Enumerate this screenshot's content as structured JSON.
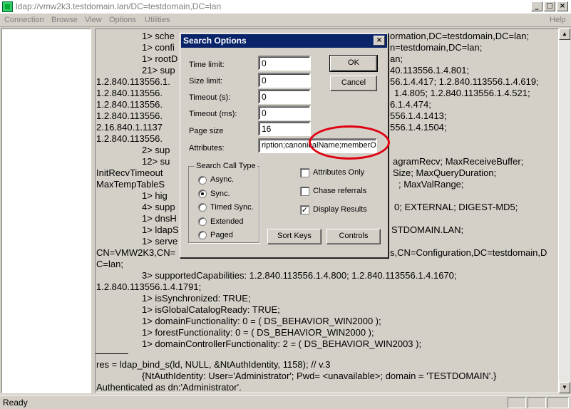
{
  "window": {
    "title": "ldap://vmw2k3.testdomain.lan/DC=testdomain,DC=lan",
    "min": "_",
    "max": "□",
    "close": "×"
  },
  "menu": {
    "items": [
      "Connection",
      "Browse",
      "View",
      "Options",
      "Utilities"
    ],
    "help": "Help"
  },
  "output": {
    "lines": [
      "1> sche",
      "1> confi",
      "1> rootD",
      "21> sup",
      "1.2.840.113556.1.",
      "1.2.840.113556.",
      "1.2.840.113556.",
      "1.2.840.113556.",
      "2.16.840.1.1137",
      "1.2.840.113556.",
      "2> sup",
      "12> su",
      "InitRecvTimeout",
      "MaxTempTableS",
      "1> hig",
      "4> supp",
      "1> dnsH",
      "1> ldapS",
      "1> serve",
      "CN=VMW2K3,CN=",
      "C=lan;",
      "3> supportedCapabilities: 1.2.840.113556.1.4.800; 1.2.840.113556.1.4.1670;",
      "1.2.840.113556.1.4.1791;",
      "1> isSynchronized: TRUE;",
      "1> isGlobalCatalogReady: TRUE;",
      "1> domainFunctionality: 0 = ( DS_BEHAVIOR_WIN2000 );",
      "1> forestFunctionality: 0 = ( DS_BEHAVIOR_WIN2000 );",
      "1> domainControllerFunctionality: 2 = ( DS_BEHAVIOR_WIN2003 );",
      "res = ldap_bind_s(ld, NULL, &NtAuthIdentity, 1158); // v.3",
      "{NtAuthIdentity: User='Administrator'; Pwd= <unavailable>; domain = 'TESTDOMAIN'.}",
      "Authenticated as dn:'Administrator'."
    ],
    "right_lines": [
      "ormation,DC=testdomain,DC=lan;",
      "n=testdomain,DC=lan;",
      "an;",
      "40.113556.1.4.801;",
      "56.1.4.417; 1.2.840.113556.1.4.619;",
      "1.4.805; 1.2.840.113556.1.4.521;",
      "6.1.4.474;",
      "556.1.4.1413;",
      "556.1.4.1504;",
      "agramRecv; MaxReceiveBuffer;",
      "Size; MaxQueryDuration;",
      "; MaxValRange;",
      "0; EXTERNAL; DIGEST-MD5;",
      "STDOMAIN.LAN;",
      "s,CN=Configuration,DC=testdomain,D"
    ]
  },
  "dialog": {
    "title": "Search Options",
    "close": "×",
    "time_limit_label": "Time limit:",
    "time_limit": "0",
    "size_limit_label": "Size limit:",
    "size_limit": "0",
    "timeout_s_label": "Timeout (s):",
    "timeout_s": "0",
    "timeout_ms_label": "Timeout (ms):",
    "timeout_ms": "0",
    "page_size_label": "Page size",
    "page_size": "16",
    "attributes_label": "Attributes:",
    "attributes": "ription;canonicalName;memberOf;",
    "ok": "OK",
    "cancel": "Cancel",
    "group_title": "Search Call Type",
    "radios": [
      "Async.",
      "Sync.",
      "Timed Sync.",
      "Extended",
      "Paged"
    ],
    "selected_radio": "Sync.",
    "check_attr_only": "Attributes Only",
    "check_chase": "Chase referrals",
    "check_display": "Display Results",
    "check_mark": "✓",
    "sort_keys": "Sort Keys",
    "controls": "Controls"
  },
  "status": {
    "text": "Ready"
  },
  "colors": {
    "dialog_title": "#0a246a",
    "highlight_ellipse": "#e00010"
  }
}
